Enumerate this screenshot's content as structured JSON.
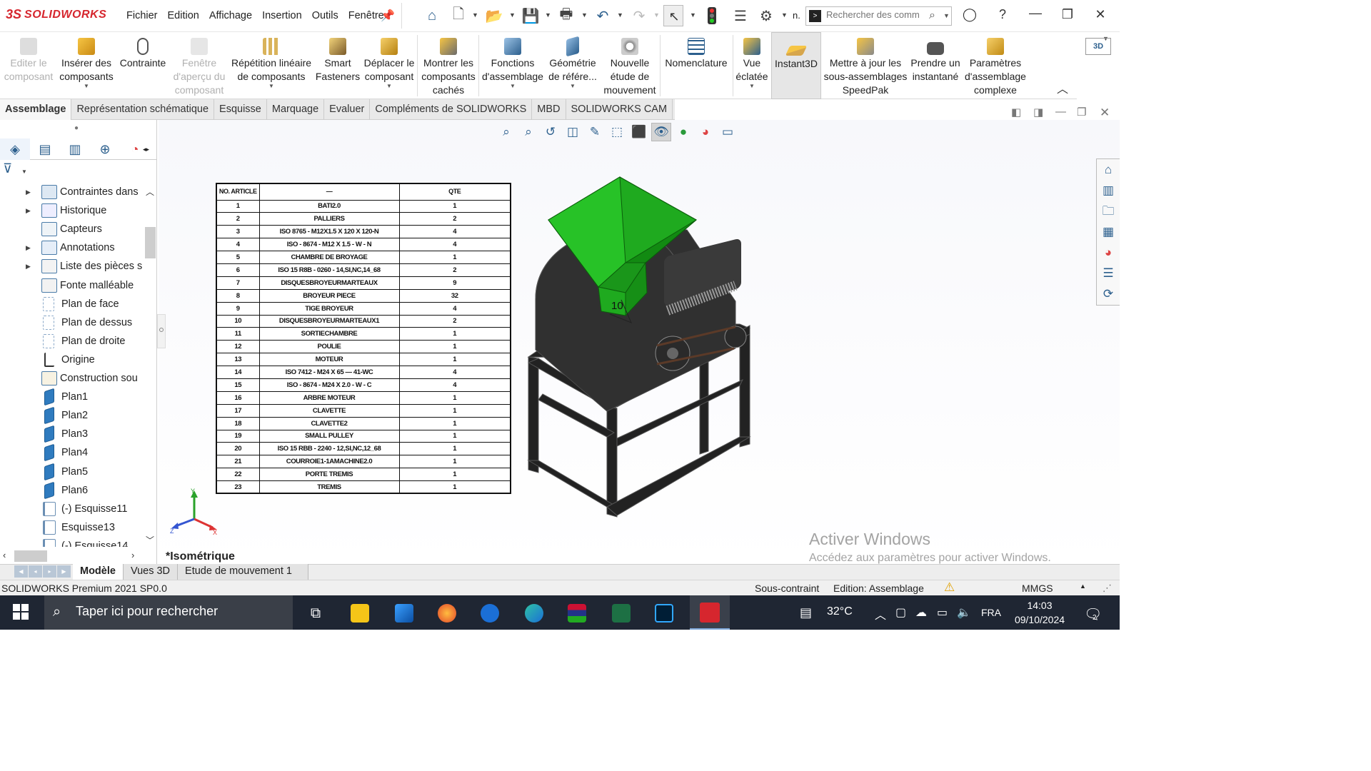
{
  "app": {
    "brand_ds": "3S",
    "brand": "SOLIDWORKS"
  },
  "menu": [
    "Fichier",
    "Edition",
    "Affichage",
    "Insertion",
    "Outils",
    "Fenêtre"
  ],
  "search": {
    "placeholder": "Rechercher des comm",
    "label": "n."
  },
  "ribbon": [
    {
      "id": "edit-component",
      "label": "Editer le composant",
      "disabled": true
    },
    {
      "id": "insert-components",
      "label": "Insérer des composants",
      "caret": true
    },
    {
      "id": "mate",
      "label": "Contrainte"
    },
    {
      "id": "preview-window",
      "label": "Fenêtre d'aperçu du composant",
      "disabled": true
    },
    {
      "id": "linear-pattern",
      "label": "Répétition linéaire de composants",
      "caret": true
    },
    {
      "id": "smart-fasteners",
      "label": "Smart Fasteners"
    },
    {
      "id": "move-component",
      "label": "Déplacer le composant",
      "caret": true
    },
    {
      "id": "show-hidden",
      "label": "Montrer les composants cachés"
    },
    {
      "id": "assembly-features",
      "label": "Fonctions d'assemblage",
      "caret": true
    },
    {
      "id": "reference-geometry",
      "label": "Géométrie de référe...",
      "caret": true
    },
    {
      "id": "new-motion-study",
      "label": "Nouvelle étude de mouvement"
    },
    {
      "id": "bill-of-materials",
      "label": "Nomenclature"
    },
    {
      "id": "exploded-view",
      "label": "Vue éclatée",
      "caret": true
    },
    {
      "id": "instant3d",
      "label": "Instant3D",
      "active": true
    },
    {
      "id": "update-speedpak",
      "label": "Mettre à jour les sous-assemblages SpeedPak"
    },
    {
      "id": "take-snapshot",
      "label": "Prendre un instantané"
    },
    {
      "id": "large-assembly",
      "label": "Paramètres d'assemblage complexe"
    }
  ],
  "ribbon_right": {
    "label": "3D"
  },
  "tabs": [
    "Assemblage",
    "Représentation schématique",
    "Esquisse",
    "Marquage",
    "Evaluer",
    "Compléments de SOLIDWORKS",
    "MBD",
    "SOLIDWORKS CAM"
  ],
  "tree": [
    {
      "label": "Contraintes dans",
      "expand": true,
      "icon": "mates"
    },
    {
      "label": "Historique",
      "expand": true,
      "icon": "history"
    },
    {
      "label": "Capteurs",
      "expand": false,
      "icon": "sensors"
    },
    {
      "label": "Annotations",
      "expand": true,
      "icon": "annotations"
    },
    {
      "label": "Liste des pièces s",
      "expand": true,
      "icon": "parts-list"
    },
    {
      "label": "Fonte malléable",
      "expand": false,
      "icon": "weldment"
    },
    {
      "label": "Plan de face",
      "expand": false,
      "icon": "refplane"
    },
    {
      "label": "Plan de dessus",
      "expand": false,
      "icon": "refplane"
    },
    {
      "label": "Plan de droite",
      "expand": false,
      "icon": "refplane"
    },
    {
      "label": "Origine",
      "expand": false,
      "icon": "origin"
    },
    {
      "label": "Construction sou",
      "expand": false,
      "icon": "construction"
    },
    {
      "label": "Plan1",
      "expand": false,
      "icon": "plane"
    },
    {
      "label": "Plan2",
      "expand": false,
      "icon": "plane"
    },
    {
      "label": "Plan3",
      "expand": false,
      "icon": "plane"
    },
    {
      "label": "Plan4",
      "expand": false,
      "icon": "plane"
    },
    {
      "label": "Plan5",
      "expand": false,
      "icon": "plane"
    },
    {
      "label": "Plan6",
      "expand": false,
      "icon": "plane"
    },
    {
      "label": "(-) Esquisse11",
      "expand": false,
      "icon": "sketch"
    },
    {
      "label": "Esquisse13",
      "expand": false,
      "icon": "sketch"
    },
    {
      "label": "(-) Esquisse14",
      "expand": false,
      "icon": "sketch"
    }
  ],
  "bom": {
    "headers": [
      "NO. ARTICLE",
      "—",
      "QTE"
    ],
    "rows": [
      [
        "1",
        "BATI2.0",
        "1"
      ],
      [
        "2",
        "PALLIERS",
        "2"
      ],
      [
        "3",
        "ISO 8765 - M12X1.5 X 120 X 120-N",
        "4"
      ],
      [
        "4",
        "ISO - 8674 - M12 X 1.5 - W - N",
        "4"
      ],
      [
        "5",
        "CHAMBRE DE BROYAGE",
        "1"
      ],
      [
        "6",
        "ISO 15 R8B - 0260 - 14,SI,NC,14_68",
        "2"
      ],
      [
        "7",
        "DISQUESBROYEURMARTEAUX",
        "9"
      ],
      [
        "8",
        "BROYEUR PIECE",
        "32"
      ],
      [
        "9",
        "TIGE BROYEUR",
        "4"
      ],
      [
        "10",
        "DISQUESBROYEURMARTEAUX1",
        "2"
      ],
      [
        "11",
        "SORTIECHAMBRE",
        "1"
      ],
      [
        "12",
        "POULIE",
        "1"
      ],
      [
        "13",
        "MOTEUR",
        "1"
      ],
      [
        "14",
        "ISO 7412 - M24 X 65 — 41-WC",
        "4"
      ],
      [
        "15",
        "ISO - 8674 - M24 X 2.0 - W - C",
        "4"
      ],
      [
        "16",
        "ARBRE MOTEUR",
        "1"
      ],
      [
        "17",
        "CLAVETTE",
        "1"
      ],
      [
        "18",
        "CLAVETTE2",
        "1"
      ],
      [
        "19",
        "SMALL PULLEY",
        "1"
      ],
      [
        "20",
        "ISO 15 RBB - 2240 - 12,SI,NC,12_68",
        "1"
      ],
      [
        "21",
        "COURROIE1-1AMACHINE2.0",
        "1"
      ],
      [
        "22",
        "PORTE TREMIS",
        "1"
      ],
      [
        "23",
        "TREMIS",
        "1"
      ]
    ]
  },
  "balloon": "10",
  "triad": {
    "x": "X",
    "y": "Y",
    "z": "Z"
  },
  "view_name": "*Isométrique",
  "watermark": {
    "line1": "Activer Windows",
    "line2": "Accédez aux paramètres pour activer Windows."
  },
  "bottom_tabs": [
    "Modèle",
    "Vues 3D",
    "Etude de mouvement 1"
  ],
  "status": {
    "product": "SOLIDWORKS Premium 2021 SP0.0",
    "state": "Sous-contraint",
    "mode": "Edition: Assemblage",
    "units": "MMGS"
  },
  "taskbar": {
    "search_placeholder": "Taper ici pour rechercher",
    "weather": "32°C",
    "lang": "FRA",
    "time": "14:03",
    "date": "09/10/2024",
    "notif": "2"
  },
  "colors": {
    "hopper": "#1faa1f",
    "body": "#2b2b2b",
    "brand": "#d6262e",
    "accent": "#2c5f8d"
  }
}
